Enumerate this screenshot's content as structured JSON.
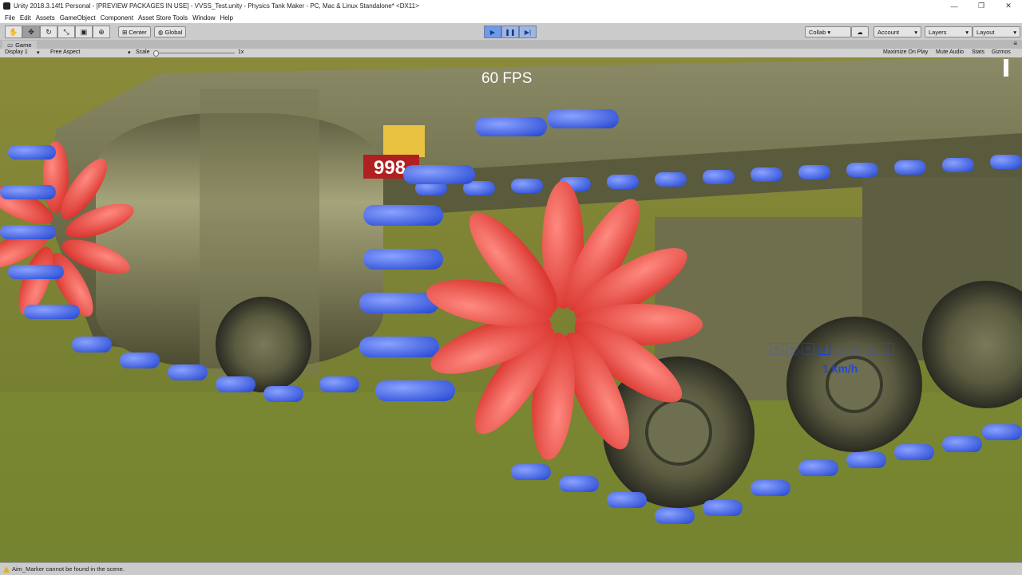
{
  "window": {
    "title": "Unity 2018.3.14f1 Personal - [PREVIEW PACKAGES IN USE] - VVSS_Test.unity - Physics Tank Maker - PC, Mac & Linux Standalone* <DX11>",
    "minimize": "—",
    "maximize": "❐",
    "close": "✕"
  },
  "menu": [
    "File",
    "Edit",
    "Assets",
    "GameObject",
    "Component",
    "Asset Store Tools",
    "Window",
    "Help"
  ],
  "toolbar": {
    "tools": [
      "hand-icon",
      "move-icon",
      "rotate-icon",
      "scale-icon",
      "rect-icon",
      "transform-icon"
    ],
    "pivot": "Center",
    "space": "Global",
    "play": "▶",
    "pause": "❚❚",
    "step": "▶|",
    "collab": "Collab ▾",
    "account": "Account",
    "layers": "Layers",
    "layout": "Layout"
  },
  "game_tab": {
    "label": "Game",
    "display": "Display 1",
    "aspect": "Free Aspect",
    "scale_label": "Scale",
    "scale_value": "1x",
    "maximize_on_play": "Maximize On Play",
    "mute_audio": "Mute Audio",
    "stats": "Stats",
    "gizmos": "Gizmos"
  },
  "game_view": {
    "fps": "60 FPS",
    "turret_number": "998",
    "gears": [
      "R",
      "R",
      "R",
      "1",
      "1",
      "2",
      "3",
      "4"
    ],
    "gear_selected_index": 3,
    "speed": "1 km/h"
  },
  "status": {
    "message": "Aim_Marker cannot be found in the scene."
  },
  "colors": {
    "red_collider": "#e8403a",
    "blue_collider": "#3d5fe0",
    "hud_blue": "#2146e0",
    "tank_olive": "#6a6a44"
  }
}
